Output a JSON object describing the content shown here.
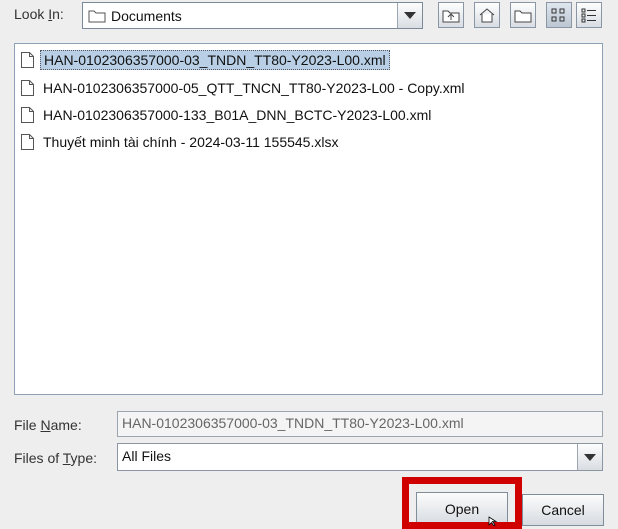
{
  "look_in": {
    "label_pre": "Look ",
    "label_mn": "I",
    "label_post": "n:",
    "value": "Documents"
  },
  "toolbar": {
    "buttons": [
      "up-folder-icon",
      "home-icon",
      "new-folder-icon",
      "list-view-icon",
      "details-view-icon"
    ]
  },
  "files": [
    {
      "name": "HAN-0102306357000-03_TNDN_TT80-Y2023-L00.xml"
    },
    {
      "name": "HAN-0102306357000-05_QTT_TNCN_TT80-Y2023-L00 - Copy.xml"
    },
    {
      "name": "HAN-0102306357000-133_B01A_DNN_BCTC-Y2023-L00.xml"
    },
    {
      "name": "Thuyết minh tài chính - 2024-03-11 155545.xlsx"
    }
  ],
  "file_name": {
    "label_pre": "File ",
    "label_mn": "N",
    "label_post": "ame:",
    "value": "HAN-0102306357000-03_TNDN_TT80-Y2023-L00.xml"
  },
  "file_type": {
    "label_pre": "Files of ",
    "label_mn": "T",
    "label_post": "ype:",
    "value": "All Files"
  },
  "actions": {
    "open": "Open",
    "cancel": "Cancel"
  },
  "colors": {
    "highlight": "#d10000",
    "selection": "#b8cfe5"
  }
}
